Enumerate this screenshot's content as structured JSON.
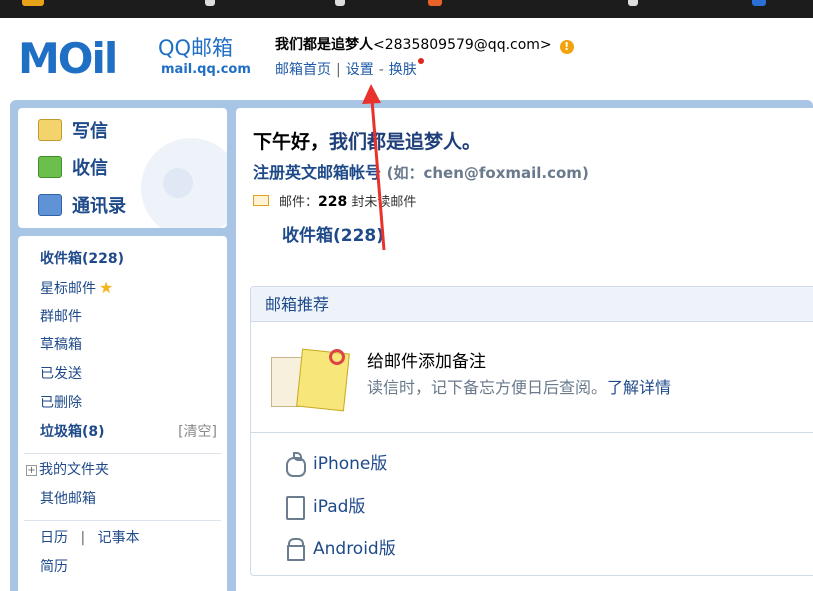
{
  "header": {
    "user_name": "我们都是追梦人",
    "user_email": "<2835809579@qq.com>",
    "logo_text": "MOil",
    "logo_brand": "QQ邮箱",
    "logo_url": "mail.qq.com",
    "links": {
      "home": "邮箱首页",
      "sep1": "|",
      "settings": "设置",
      "sep2": "-",
      "skin": "换肤"
    }
  },
  "quick_actions": {
    "write": "写信",
    "receive": "收信",
    "contacts": "通讯录"
  },
  "folders": {
    "inbox": "收件箱(228)",
    "starred": "星标邮件",
    "group": "群邮件",
    "drafts": "草稿箱",
    "sent": "已发送",
    "deleted": "已删除",
    "spam": "垃圾箱(8)",
    "spam_clear": "[清空]",
    "my_folders": "我的文件夹",
    "other_mailboxes": "其他邮箱",
    "calendar": "日历",
    "cal_sep": "|",
    "notes": "记事本",
    "resume": "简历"
  },
  "main": {
    "greeting_prefix": "下午好，",
    "greeting_name": "我们都是追梦人。",
    "register_link": "注册英文邮箱帐号",
    "register_hint": "(如：chen@foxmail.com)",
    "mail_label": "邮件：",
    "unread_count": "228",
    "unread_suffix": "封未读邮件",
    "inbox_link": "收件箱(228)"
  },
  "recommend": {
    "title": "邮箱推荐",
    "feature_title": "给邮件添加备注",
    "feature_desc": "读信时，记下备忘方便日后查阅。",
    "feature_more": "了解详情",
    "devices": [
      "iPhone版",
      "iPad版",
      "Android版"
    ]
  },
  "colors": {
    "frame_blue": "#a9c5e6",
    "link_blue": "#1f4a8a",
    "arrow_red": "#e8322b",
    "logo_orange": "#e8622a"
  },
  "icons": [
    "write-icon",
    "inbox-icon",
    "contacts-icon",
    "star-icon",
    "warning-icon",
    "envelope-icon",
    "note-icon",
    "apple-icon",
    "ipad-icon",
    "android-icon"
  ]
}
